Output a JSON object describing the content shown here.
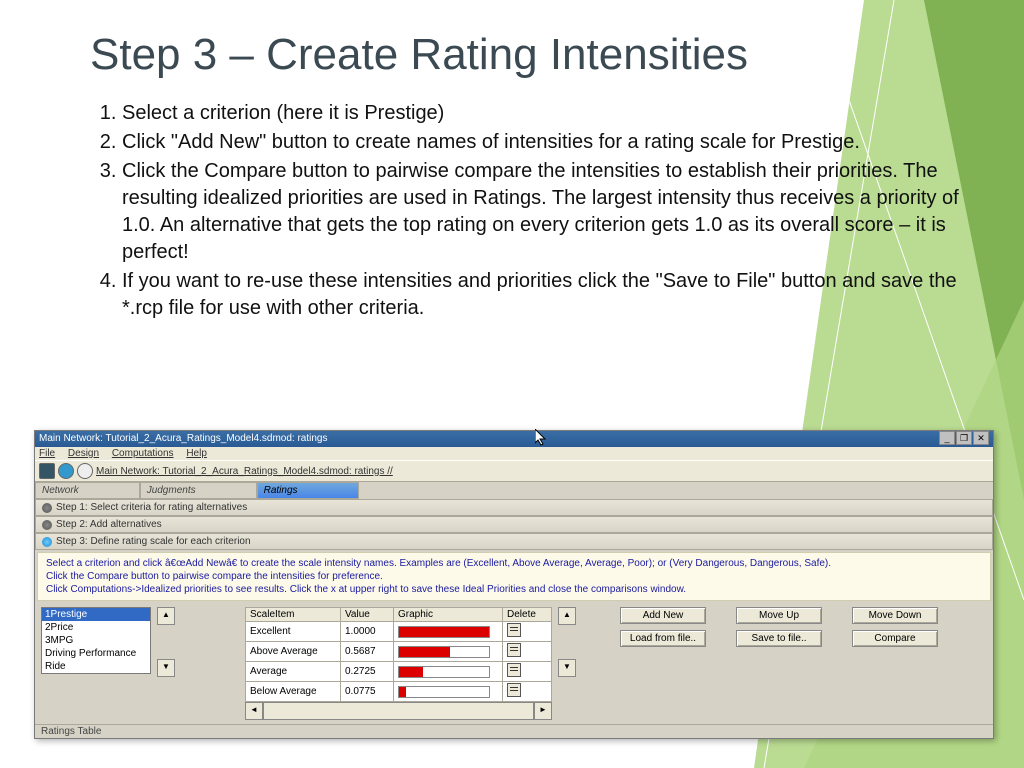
{
  "slide": {
    "title": "Step 3 – Create Rating Intensities",
    "bullets": [
      "Select a criterion (here it is Prestige)",
      "Click \"Add New\" button to create names of intensities for a rating scale for Prestige.",
      "Click the Compare button to pairwise compare the intensities to establish their priorities. The resulting idealized priorities are used in Ratings. The largest intensity thus receives a priority of 1.0. An alternative that gets the top rating on every criterion gets 1.0 as its overall score – it is perfect!",
      "If you want to re-use these intensities and priorities click the \"Save to File\" button and save the *.rcp file for use with other criteria."
    ]
  },
  "app": {
    "title": "Main Network: Tutorial_2_Acura_Ratings_Model4.sdmod: ratings",
    "menu": [
      "File",
      "Design",
      "Computations",
      "Help"
    ],
    "path": "Main Network: Tutorial_2_Acura_Ratings_Model4.sdmod: ratings //",
    "tabs": {
      "t1": "Network",
      "t2": "Judgments",
      "t3": "Ratings"
    },
    "steps": {
      "s1": "Step 1: Select criteria for rating alternatives",
      "s2": "Step 2: Add alternatives",
      "s3": "Step 3: Define rating scale for each criterion"
    },
    "instr_l1": "Select a criterion and click â€œAdd Newâ€ to create the scale intensity names. Examples are (Excellent, Above Average, Average, Poor); or (Very Dangerous, Dangerous, Safe).",
    "instr_l2": "Click the Compare button to pairwise compare the intensities for preference.",
    "instr_l3": "Click Computations->Idealized priorities to see results. Click the x at upper right to save these Ideal Priorities and close the comparisons window.",
    "criteria": [
      "1Prestige",
      "2Price",
      "3MPG",
      "Driving Performance",
      "Ride"
    ],
    "headers": {
      "h1": "ScaleItem",
      "h2": "Value",
      "h3": "Graphic",
      "h4": "Delete"
    },
    "rows": [
      {
        "name": "Excellent",
        "value": "1.0000",
        "pct": 100
      },
      {
        "name": "Above Average",
        "value": "0.5687",
        "pct": 57
      },
      {
        "name": "Average",
        "value": "0.2725",
        "pct": 27
      },
      {
        "name": "Below Average",
        "value": "0.0775",
        "pct": 8
      }
    ],
    "buttons": {
      "addnew": "Add New",
      "moveup": "Move Up",
      "movedown": "Move Down",
      "load": "Load from file..",
      "save": "Save to file..",
      "compare": "Compare"
    },
    "status": "Ratings Table"
  }
}
